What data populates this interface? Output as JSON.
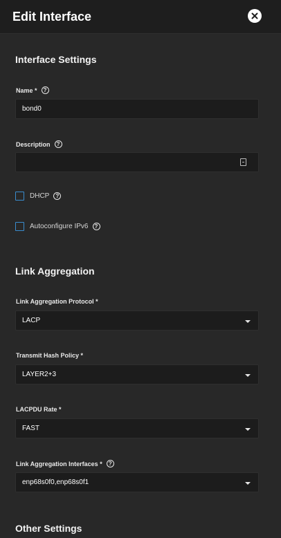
{
  "dialog": {
    "title": "Edit Interface"
  },
  "interface_settings": {
    "title": "Interface Settings",
    "name": {
      "label": "Name *",
      "value": "bond0"
    },
    "description": {
      "label": "Description",
      "value": ""
    },
    "dhcp": {
      "label": "DHCP",
      "checked": false
    },
    "autoconfigure_ipv6": {
      "label": "Autoconfigure IPv6",
      "checked": false
    }
  },
  "link_aggregation": {
    "title": "Link Aggregation",
    "protocol": {
      "label": "Link Aggregation Protocol *",
      "value": "LACP"
    },
    "hash_policy": {
      "label": "Transmit Hash Policy *",
      "value": "LAYER2+3"
    },
    "lacpdu_rate": {
      "label": "LACPDU Rate *",
      "value": "FAST"
    },
    "interfaces": {
      "label": "Link Aggregation Interfaces *",
      "value": "enp68s0f0,enp68s0f1"
    }
  },
  "other_settings": {
    "title": "Other Settings"
  },
  "colors": {
    "background": "#1e1e1e",
    "panel": "#282828",
    "input": "#1c1c1c",
    "checkbox_accent": "#3a8dcf"
  },
  "icons": {
    "close": "close-icon",
    "help": "help-icon",
    "dropdown": "chevron-down-icon",
    "textarea": "document-icon"
  }
}
